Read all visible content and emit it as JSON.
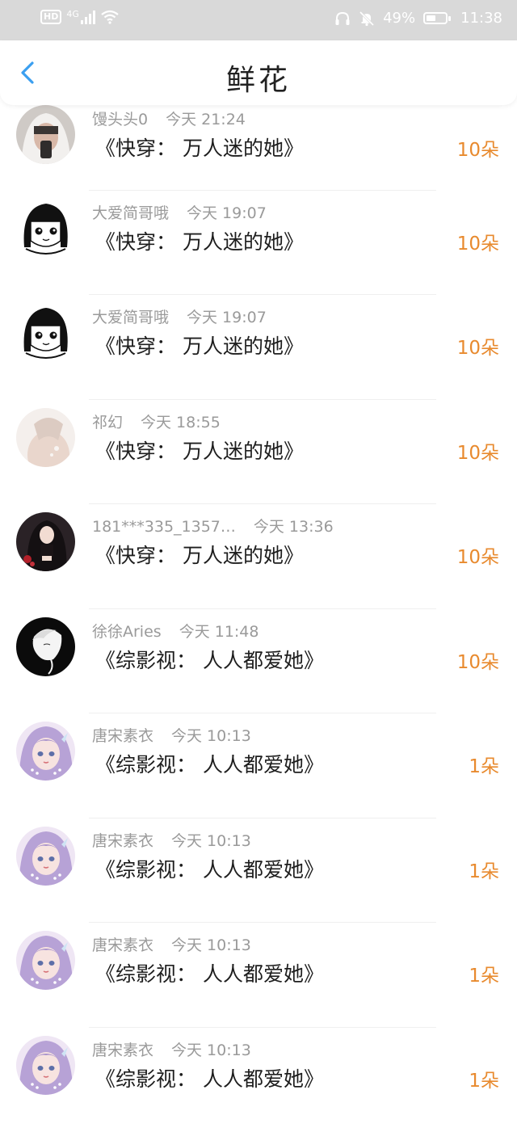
{
  "status_bar": {
    "hd_label": "HD",
    "network": "4G",
    "battery_percent": "49%",
    "battery_level": 0.49,
    "time": "11:38"
  },
  "header": {
    "title": "鲜花"
  },
  "colors": {
    "accent_blue": "#3b9ff0",
    "flower_orange": "#e88a2e"
  },
  "gifts": [
    {
      "user": "馒头头0",
      "time": "今天 21:24",
      "book": "《快穿： 万人迷的她》",
      "amount": "10朵",
      "avatar": "avatar-girl-white-hood"
    },
    {
      "user": "大爱简哥哦",
      "time": "今天 19:07",
      "book": "《快穿： 万人迷的她》",
      "amount": "10朵",
      "avatar": "avatar-manga-girl"
    },
    {
      "user": "大爱简哥哦",
      "time": "今天 19:07",
      "book": "《快穿： 万人迷的她》",
      "amount": "10朵",
      "avatar": "avatar-manga-girl"
    },
    {
      "user": "祁幻",
      "time": "今天 18:55",
      "book": "《快穿： 万人迷的她》",
      "amount": "10朵",
      "avatar": "avatar-back-portrait"
    },
    {
      "user": "181***335_1357…",
      "time": "今天 13:36",
      "book": "《快穿： 万人迷的她》",
      "amount": "10朵",
      "avatar": "avatar-dark-anime-girl"
    },
    {
      "user": "徐徐Aries",
      "time": "今天 11:48",
      "book": "《综影视： 人人都爱她》",
      "amount": "10朵",
      "avatar": "avatar-sketch-boy"
    },
    {
      "user": "唐宋素衣",
      "time": "今天 10:13",
      "book": "《综影视： 人人都爱她》",
      "amount": "1朵",
      "avatar": "avatar-purple-hair-girl"
    },
    {
      "user": "唐宋素衣",
      "time": "今天 10:13",
      "book": "《综影视： 人人都爱她》",
      "amount": "1朵",
      "avatar": "avatar-purple-hair-girl"
    },
    {
      "user": "唐宋素衣",
      "time": "今天 10:13",
      "book": "《综影视： 人人都爱她》",
      "amount": "1朵",
      "avatar": "avatar-purple-hair-girl"
    },
    {
      "user": "唐宋素衣",
      "time": "今天 10:13",
      "book": "《综影视： 人人都爱她》",
      "amount": "1朵",
      "avatar": "avatar-purple-hair-girl"
    }
  ]
}
